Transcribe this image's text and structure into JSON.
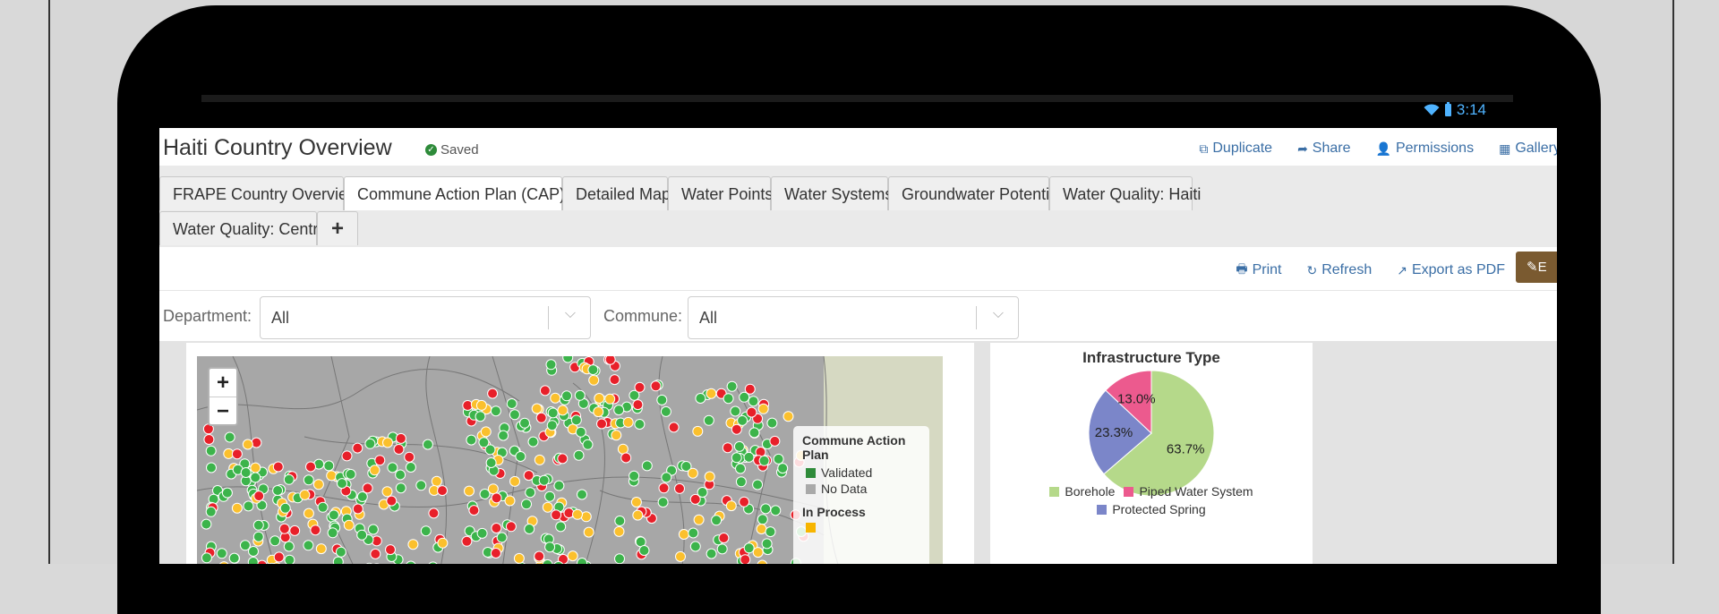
{
  "status": {
    "time": "3:14"
  },
  "header": {
    "title": "Haiti Country Overview",
    "saved": "Saved",
    "actions": [
      "Duplicate",
      "Share",
      "Permissions",
      "Gallery"
    ]
  },
  "tabs": [
    {
      "label": "FRAPE Country Overview"
    },
    {
      "label": "Commune Action Plan (CAP)",
      "active": true,
      "close": "✖"
    },
    {
      "label": "Detailed Map"
    },
    {
      "label": "Water Points"
    },
    {
      "label": "Water Systems"
    },
    {
      "label": "Groundwater Potential"
    },
    {
      "label": "Water Quality: Haiti"
    },
    {
      "label": "Water Quality: Centre"
    },
    {
      "label": "+"
    }
  ],
  "toolbar": {
    "print": "Print",
    "refresh": "Refresh",
    "export": "Export as PDF",
    "edit": "E"
  },
  "filters": {
    "department": {
      "label": "Department:",
      "value": "All"
    },
    "commune": {
      "label": "Commune:",
      "value": "All"
    }
  },
  "map": {
    "zoom_in": "+",
    "zoom_out": "−",
    "legend": {
      "title": "Commune Action Plan",
      "items": [
        {
          "label": "Validated",
          "color": "#2e8b3a"
        },
        {
          "label": "No Data",
          "color": "#a9a9a9"
        }
      ],
      "section": "In Process",
      "section_color": "#f7b500"
    },
    "colors": {
      "green": "#3cb44b",
      "red": "#e8202a",
      "yellow": "#fbc02d"
    }
  },
  "chart_data": {
    "type": "pie",
    "title": "Infrastructure Type",
    "slices": [
      {
        "name": "Borehole",
        "value": 63.7,
        "label": "63.7%",
        "color": "#b5d98a"
      },
      {
        "name": "Protected Spring",
        "value": 23.3,
        "label": "23.3%",
        "color": "#7b86c9"
      },
      {
        "name": "Piped Water System",
        "value": 13.0,
        "label": "13.0%",
        "color": "#ec5a8e"
      }
    ],
    "legend": [
      "Borehole",
      "Piped Water System",
      "Protected Spring"
    ]
  }
}
